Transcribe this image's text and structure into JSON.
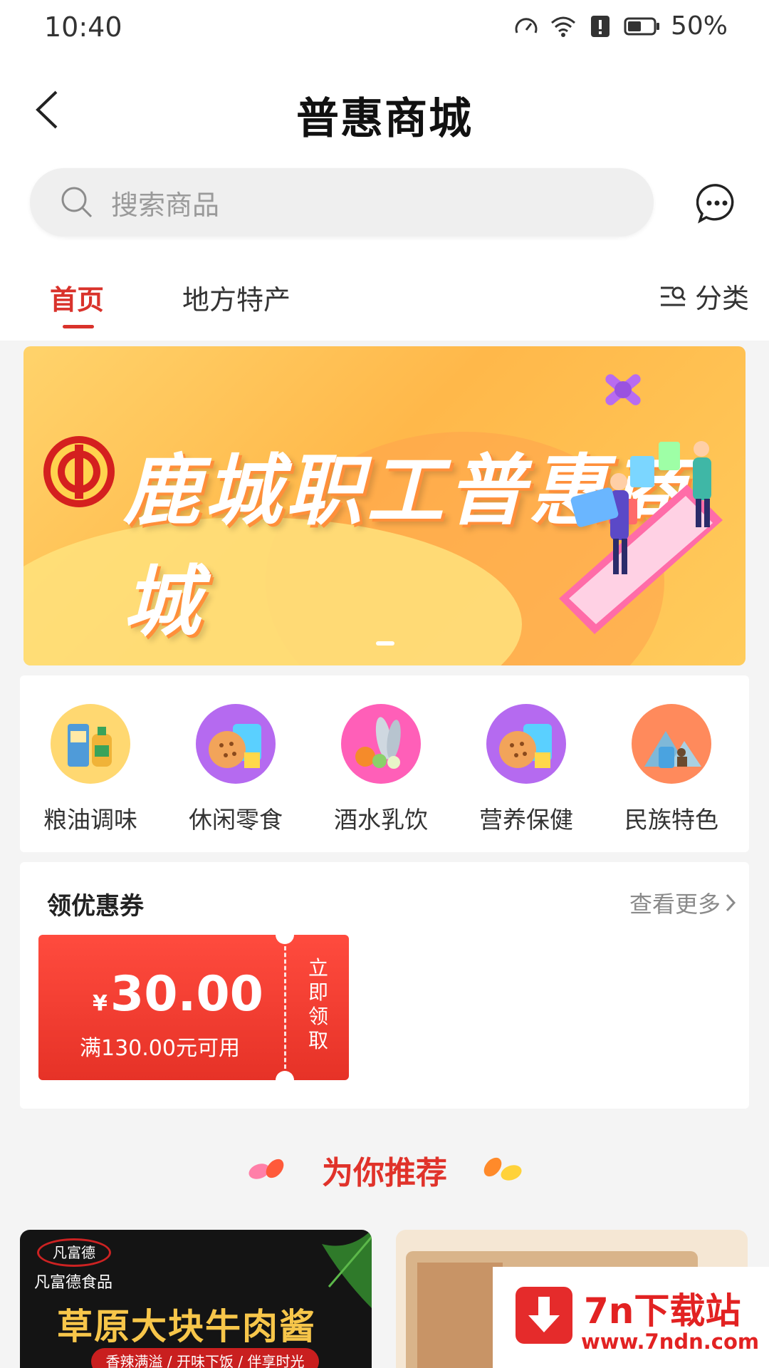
{
  "status_bar": {
    "time": "10:40",
    "battery": "50%"
  },
  "header": {
    "title": "普惠商城"
  },
  "search": {
    "placeholder": "搜索商品"
  },
  "tabs": [
    {
      "label": "首页",
      "active": true
    },
    {
      "label": "地方特产",
      "active": false
    }
  ],
  "category_button": "分类",
  "banner": {
    "title": "鹿城职工普惠商城"
  },
  "categories": [
    {
      "label": "粮油调味",
      "icon": "grain-oil-icon"
    },
    {
      "label": "休闲零食",
      "icon": "snack-icon"
    },
    {
      "label": "酒水乳饮",
      "icon": "drinks-icon"
    },
    {
      "label": "营养保健",
      "icon": "nutrition-icon"
    },
    {
      "label": "民族特色",
      "icon": "ethnic-icon"
    }
  ],
  "coupons_section": {
    "title": "领优惠券",
    "more": "查看更多",
    "coupon": {
      "currency": "¥",
      "amount": "30.00",
      "condition": "满130.00元可用",
      "claim": "立即领取"
    }
  },
  "recommend": {
    "title": "为你推荐"
  },
  "products": [
    {
      "brand_logo": "凡富德",
      "brand": "凡富德食品",
      "title": "草原大块牛肉酱",
      "tagline": "香辣满溢 / 开味下饭 / 伴享时光"
    }
  ],
  "watermark": {
    "title": "7n下载站",
    "url": "www.7ndn.com"
  },
  "colors": {
    "accent": "#d9322b",
    "coupon": "#e63227",
    "banner": "#ffb84a"
  }
}
